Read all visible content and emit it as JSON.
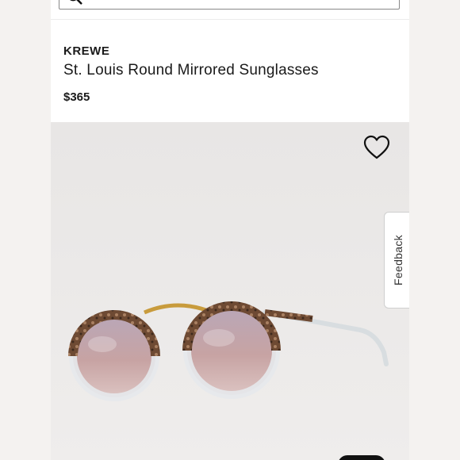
{
  "search": {
    "placeholder": ""
  },
  "product": {
    "brand": "KREWE",
    "title": "St. Louis Round Mirrored Sunglasses",
    "price": "$365"
  },
  "feedback": {
    "label": "Feedback"
  },
  "colors": {
    "background": "#ffffff",
    "image_bg": "#e9e7e6",
    "text": "#1a1a1a"
  },
  "icons": [
    "search-icon",
    "heart-icon"
  ]
}
